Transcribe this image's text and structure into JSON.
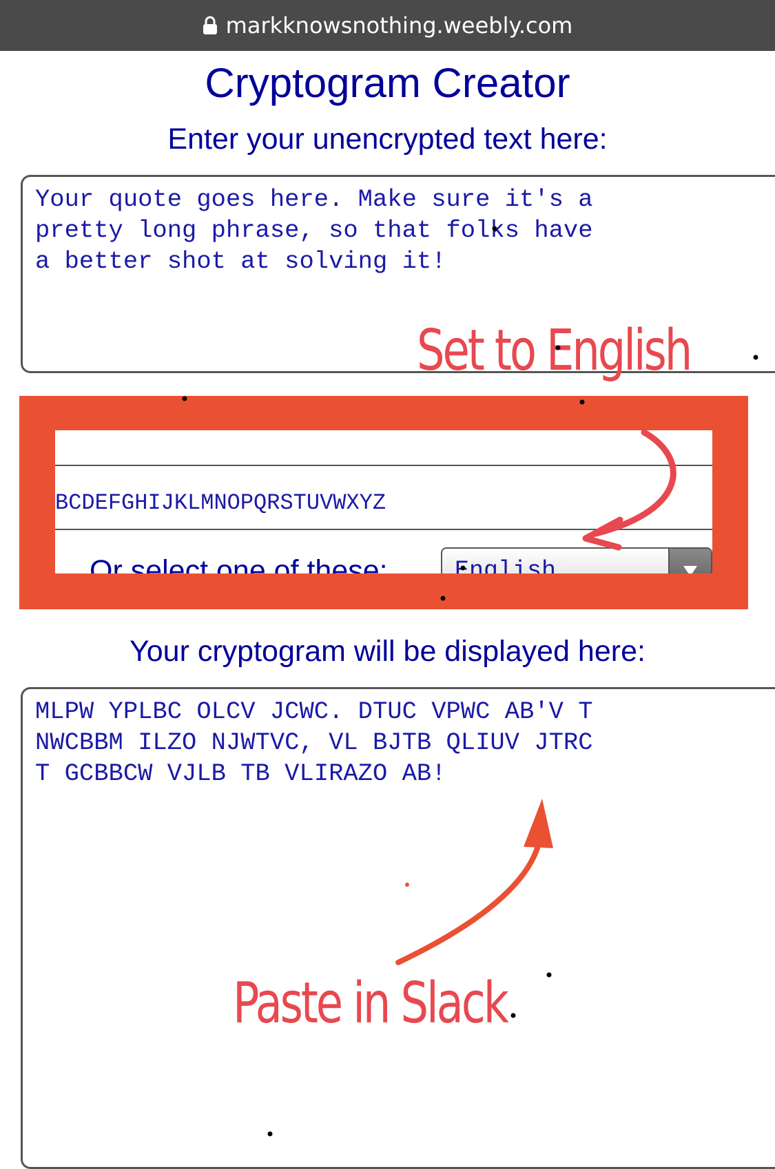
{
  "browser": {
    "url": "markknowsnothing.weebly.com"
  },
  "page": {
    "title": "Cryptogram Creator",
    "input_heading": "Enter your unencrypted text here:",
    "input_text": "Your quote goes here. Make sure it's a\npretty long phrase, so that folks have\na better shot at solving it!",
    "key_alphabet": "BCDEFGHIJKLMNOPQRSTUVWXYZ",
    "select_label": "Or select one of these:",
    "select_value": "English",
    "output_heading": "Your cryptogram will be displayed here:",
    "output_text": "MLPW YPLBC OLCV JCWC. DTUC VPWC AB'V T\nNWCBBM ILZO NJWTVC, VL BJTB QLIUV JTRC\nT GCBBCW VJLB TB VLIRAZO AB!"
  },
  "annotations": {
    "set_language": "Set to English",
    "paste": "Paste in Slack",
    "accent_color": "#ea5133",
    "ink_color": "#e8484f"
  }
}
